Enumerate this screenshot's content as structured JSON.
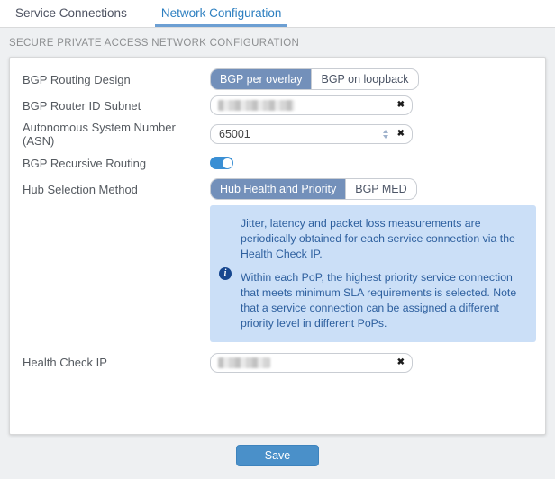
{
  "tabs": {
    "service_connections": "Service Connections",
    "network_configuration": "Network Configuration"
  },
  "section_title": "SECURE PRIVATE ACCESS NETWORK CONFIGURATION",
  "form": {
    "bgp_routing_design": {
      "label": "BGP Routing Design",
      "option_selected": "BGP per overlay",
      "option_other": "BGP on loopback"
    },
    "bgp_router_id_subnet": {
      "label": "BGP Router ID Subnet",
      "value": "",
      "redacted": true
    },
    "asn": {
      "label": "Autonomous System Number (ASN)",
      "value": "65001"
    },
    "bgp_recursive_routing": {
      "label": "BGP Recursive Routing",
      "state": "on"
    },
    "hub_selection_method": {
      "label": "Hub Selection Method",
      "option_selected": "Hub Health and Priority",
      "option_other": "BGP MED"
    },
    "info_note": {
      "paragraph_1": "Jitter, latency and packet loss measurements are periodically obtained for each service connection via the Health Check IP.",
      "paragraph_2": "Within each PoP, the highest priority service connection that meets minimum SLA requirements is selected. Note that a service connection can be assigned a different priority level in different PoPs."
    },
    "health_check_ip": {
      "label": "Health Check IP",
      "value": "",
      "redacted": true
    }
  },
  "actions": {
    "save": "Save"
  },
  "icons": {
    "clear_glyph": "✖",
    "info_glyph": "i"
  },
  "colors": {
    "active_tab": "#2d7fc0",
    "tab_underline": "#6c9fd3",
    "segment_selected_bg": "#7390ba",
    "toggle_on": "#3a8fd4",
    "info_bg": "#cbdff7",
    "info_text": "#2d5f9e",
    "info_icon_bg": "#17478f",
    "save_button_bg": "#4a90c9",
    "page_bg": "#eef0f2"
  }
}
